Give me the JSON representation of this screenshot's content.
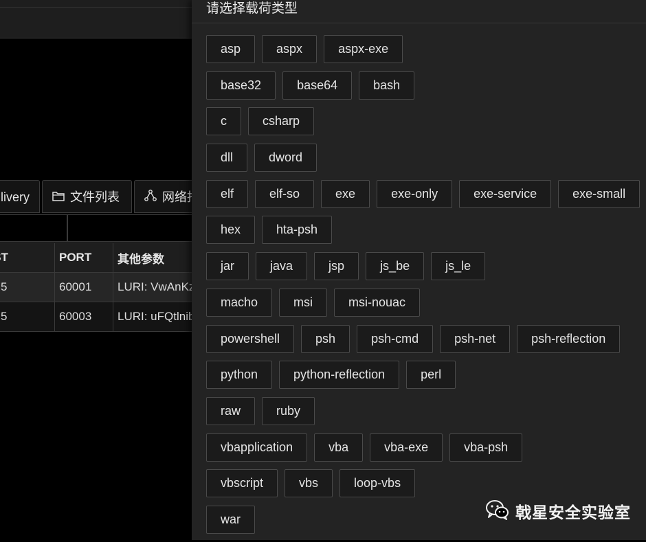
{
  "background": {
    "tabs": [
      {
        "label": "livery"
      },
      {
        "icon": "folder-icon",
        "label": "文件列表"
      },
      {
        "icon": "network-icon",
        "label": "网络抖"
      }
    ],
    "table": {
      "headers": [
        "OST",
        "PORT",
        "其他参数"
      ],
      "rows": [
        [
          "5",
          "60001",
          "LURI: VwAnKz"
        ],
        [
          "5",
          "60003",
          "LURI: uFQtlnib"
        ]
      ]
    }
  },
  "drawer": {
    "title": "请选择载荷类型",
    "rows": [
      [
        "asp",
        "aspx",
        "aspx-exe"
      ],
      [
        "base32",
        "base64",
        "bash"
      ],
      [
        "c",
        "csharp"
      ],
      [
        "dll",
        "dword"
      ],
      [
        "elf",
        "elf-so",
        "exe",
        "exe-only",
        "exe-service",
        "exe-small"
      ],
      [
        "hex",
        "hta-psh"
      ],
      [
        "jar",
        "java",
        "jsp",
        "js_be",
        "js_le"
      ],
      [
        "macho",
        "msi",
        "msi-nouac"
      ],
      [
        "powershell",
        "psh",
        "psh-cmd",
        "psh-net",
        "psh-reflection"
      ],
      [
        "python",
        "python-reflection",
        "perl"
      ],
      [
        "raw",
        "ruby"
      ],
      [
        "vbapplication",
        "vba",
        "vba-exe",
        "vba-psh"
      ],
      [
        "vbscript",
        "vbs",
        "loop-vbs"
      ],
      [
        "war"
      ]
    ]
  },
  "watermark": {
    "icon": "wechat-icon",
    "text": "戟星安全实验室"
  }
}
